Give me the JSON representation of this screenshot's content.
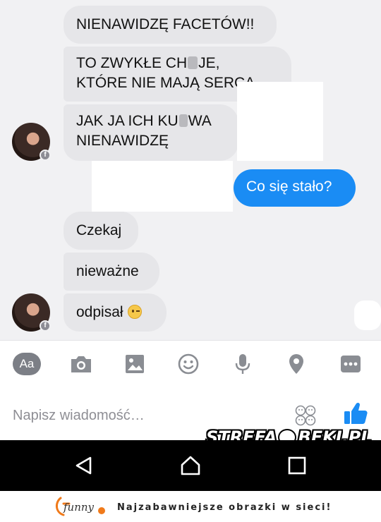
{
  "messages": {
    "m1": "NIENAWIDZĘ FACETÓW!!",
    "m2_line1": "TO ZWYKŁE CH",
    "m2_line1_end": "JE,",
    "m2_line2": "KTÓRE NIE MAJĄ SERCA",
    "m3_line1": "JAK JA ICH KU",
    "m3_line1_end": "WA",
    "m3_line2": "NIENAWIDZĘ",
    "outgoing": "Co się stało?",
    "m4": "Czekaj",
    "m5": "nieważne",
    "m6": "odpisał"
  },
  "toolbar": {
    "text_format_label": "Aa",
    "icons": [
      "text-format-icon",
      "camera-icon",
      "gallery-icon",
      "emoji-icon",
      "microphone-icon",
      "location-icon",
      "more-icon"
    ]
  },
  "compose": {
    "placeholder": "Napisz wiadomość…"
  },
  "watermark": {
    "left": "STREFA",
    "right": "BEKI.PL"
  },
  "footer": {
    "logo": "funny",
    "tagline": "Najzabawniejsze obrazki w sieci!"
  },
  "colors": {
    "incoming_bubble": "#e6e6e9",
    "outgoing_bubble": "#1a8cf4",
    "chat_bg": "#f1f1f3",
    "icon_gray": "#8a8d93",
    "like_blue": "#1a8cf4",
    "logo_orange": "#f07a1a"
  }
}
